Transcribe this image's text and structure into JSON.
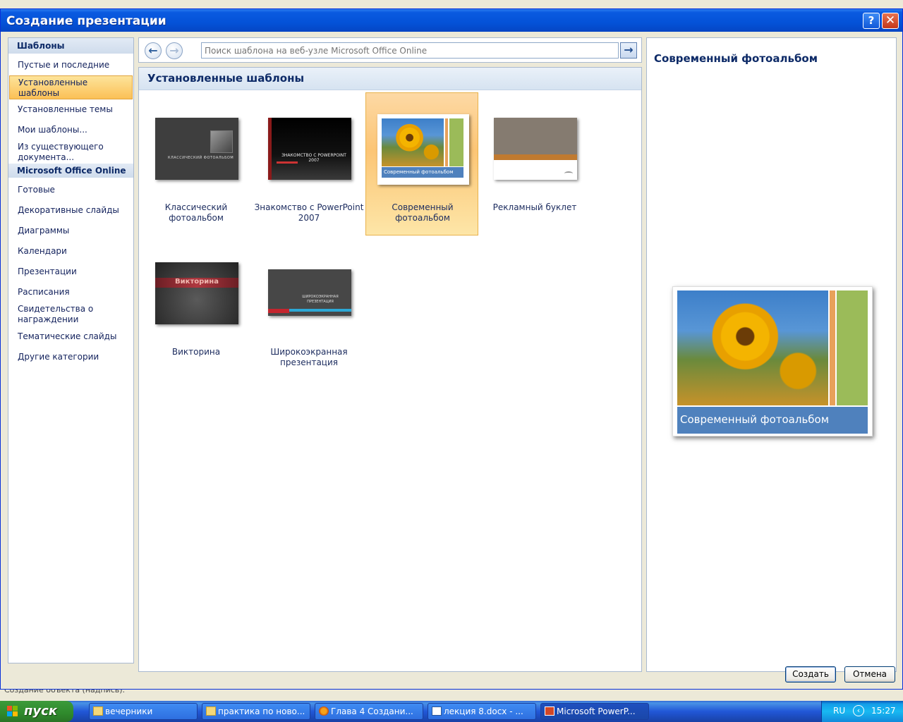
{
  "dialog": {
    "title": "Создание презентации",
    "help_label": "?",
    "close_label": "✕"
  },
  "leftnav": {
    "header_templates": "Шаблоны",
    "items": [
      {
        "label": "Пустые и последние"
      },
      {
        "label": "Установленные шаблоны",
        "selected": true
      },
      {
        "label": "Установленные темы"
      },
      {
        "label": "Мои шаблоны..."
      },
      {
        "label": "Из существующего документа..."
      }
    ],
    "header_online": "Microsoft Office Online",
    "online_items": [
      {
        "label": "Готовые"
      },
      {
        "label": "Декоративные слайды"
      },
      {
        "label": "Диаграммы"
      },
      {
        "label": "Календари"
      },
      {
        "label": "Презентации"
      },
      {
        "label": "Расписания"
      },
      {
        "label": "Свидетельства о награждении"
      },
      {
        "label": "Тематические слайды"
      },
      {
        "label": "Другие категории"
      }
    ]
  },
  "toolbar": {
    "back_icon": "←",
    "forward_icon": "→",
    "search_placeholder": "Поиск шаблона на веб-узле Microsoft Office Online",
    "search_go_icon": "→"
  },
  "gallery": {
    "header": "Установленные шаблоны",
    "tiles": [
      {
        "label": "Классический фотоальбом",
        "thumb_text": "КЛАССИЧЕСКИЙ ФОТОАЛЬБОМ"
      },
      {
        "label": "Знакомство с PowerPoint 2007",
        "thumb_text": "ЗНАКОМСТВО С POWERPOINT 2007"
      },
      {
        "label": "Современный фотоальбом",
        "thumb_text": "Современный фотоальбом",
        "selected": true
      },
      {
        "label": "Рекламный буклет"
      },
      {
        "label": "Викторина",
        "thumb_text": "Викторина"
      },
      {
        "label": "Широкоэкранная презентация",
        "thumb_text": "ШИРОКОЭКРАННАЯ ПРЕЗЕНТАЦИЯ"
      }
    ]
  },
  "preview": {
    "title": "Современный фотоальбом",
    "image_caption": "Современный фотоальбом"
  },
  "buttons": {
    "create": "Создать",
    "cancel": "Отмена"
  },
  "background": {
    "status_text": "Создание объекта (надпись)."
  },
  "taskbar": {
    "start_label": "пуск",
    "tasks": [
      {
        "label": "вечерники",
        "icon": "folder-icon"
      },
      {
        "label": "практика по ново...",
        "icon": "folder-icon"
      },
      {
        "label": "Глава 4 Создани...",
        "icon": "firefox-icon"
      },
      {
        "label": "лекция 8.docx - ...",
        "icon": "word-icon"
      },
      {
        "label": "Microsoft PowerP...",
        "icon": "powerpoint-icon",
        "active": true
      }
    ],
    "language": "RU",
    "clock": "15:27"
  },
  "colors": {
    "accent": "#0452d8",
    "selected": "#fcc575",
    "header_text": "#0d2a67"
  }
}
